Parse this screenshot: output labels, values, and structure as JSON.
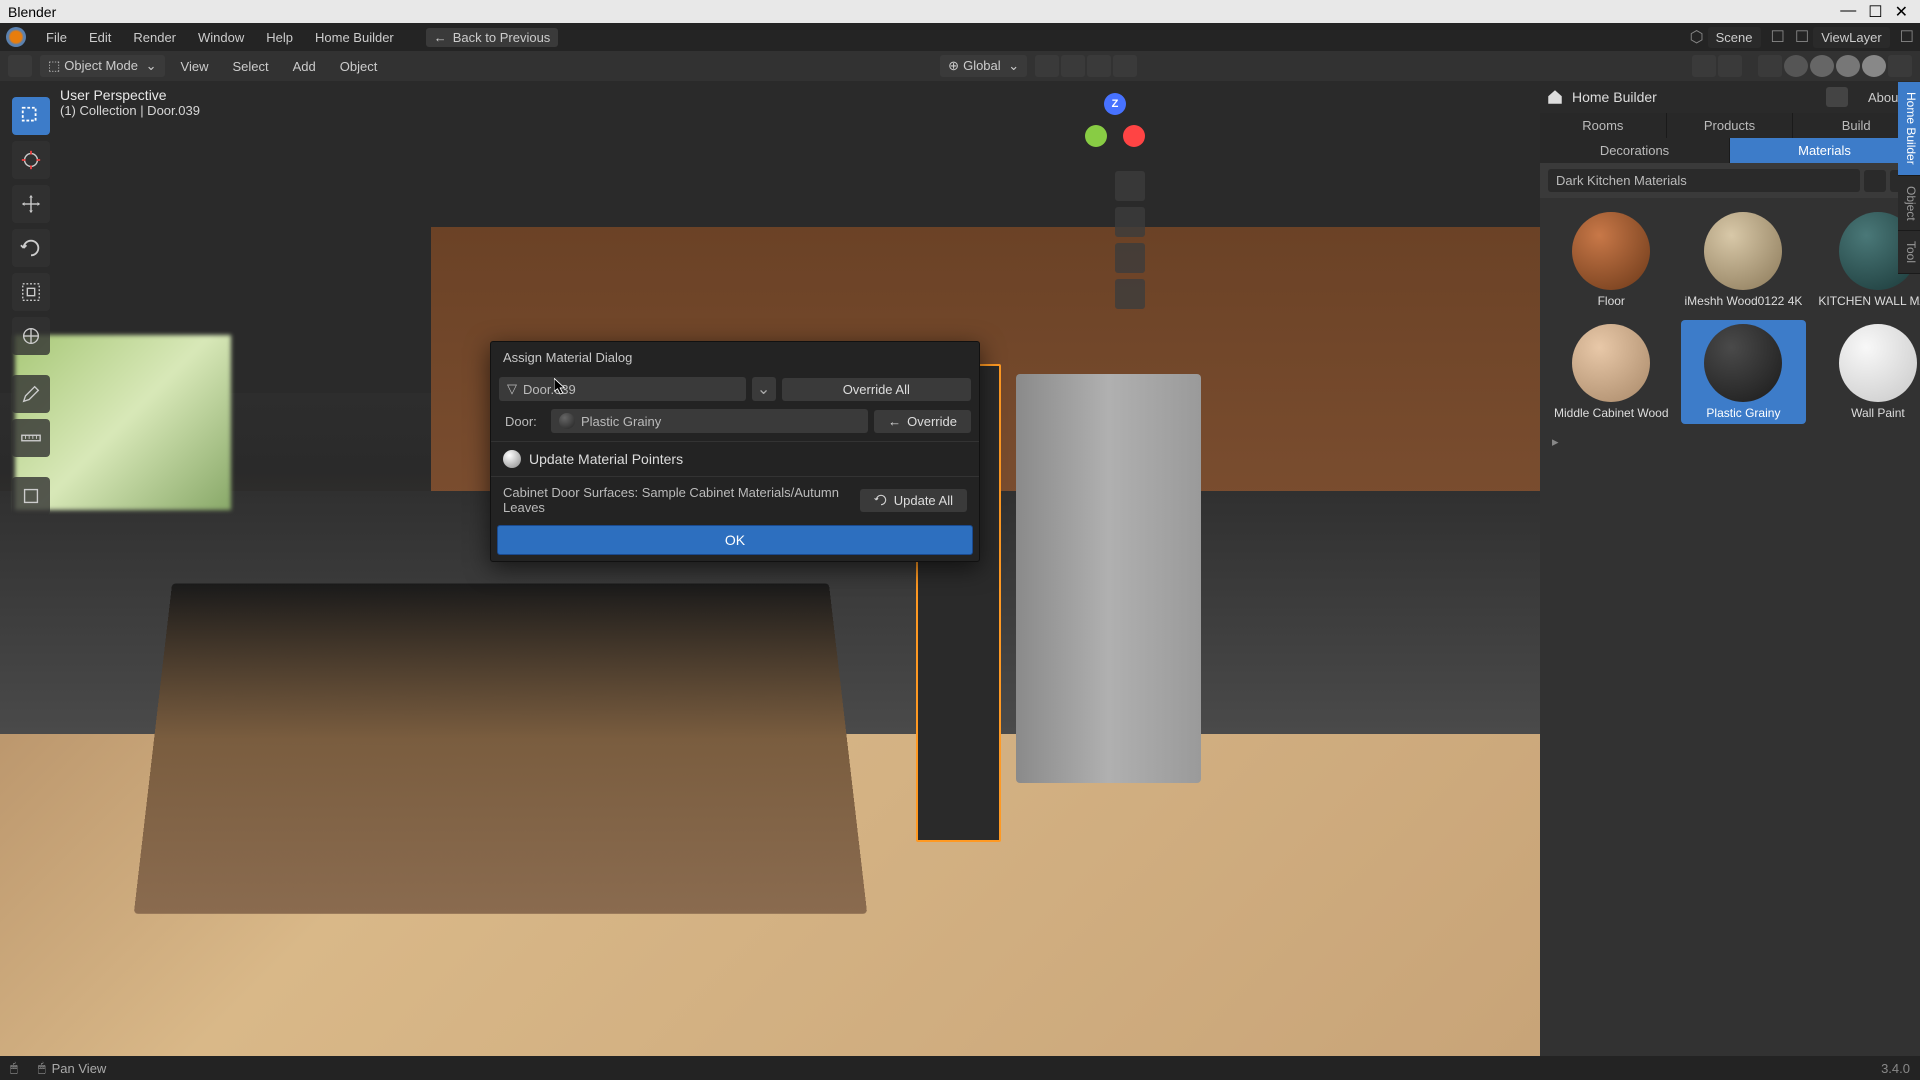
{
  "app_title": "Blender",
  "menu": {
    "file": "File",
    "edit": "Edit",
    "render": "Render",
    "window": "Window",
    "help": "Help",
    "home_builder": "Home Builder",
    "back": "Back to Previous"
  },
  "scene": {
    "scene_label": "Scene",
    "viewlayer_label": "ViewLayer"
  },
  "toolbar": {
    "mode": "Object Mode",
    "view": "View",
    "select": "Select",
    "add": "Add",
    "object": "Object",
    "orientation": "Global"
  },
  "viewport": {
    "perspective": "User Perspective",
    "object_path": "(1) Collection | Door.039"
  },
  "dialog": {
    "title": "Assign Material Dialog",
    "object_name": "Door.039",
    "override_all": "Override All",
    "door_label": "Door:",
    "material_name": "Plastic Grainy",
    "override": "Override",
    "update_pointers": "Update Material Pointers",
    "surfaces_text": "Cabinet Door Surfaces: Sample Cabinet Materials/Autumn Leaves",
    "update_all": "Update All",
    "ok": "OK"
  },
  "right_panel": {
    "title": "Home Builder",
    "about": "About",
    "tabs": {
      "rooms": "Rooms",
      "products": "Products",
      "build": "Build",
      "decorations": "Decorations",
      "materials": "Materials"
    },
    "category": "Dark Kitchen Materials",
    "materials": {
      "floor": "Floor",
      "wood": "iMeshh Wood0122 4K",
      "kitchen_wall": "KITCHEN WALL MA...",
      "middle": "Middle Cabinet Wood",
      "plastic": "Plastic Grainy",
      "wall_paint": "Wall Paint"
    }
  },
  "side_tabs": {
    "home_builder": "Home Builder",
    "object": "Object",
    "tool": "Tool"
  },
  "status": {
    "pan": "Pan View",
    "version": "3.4.0"
  }
}
